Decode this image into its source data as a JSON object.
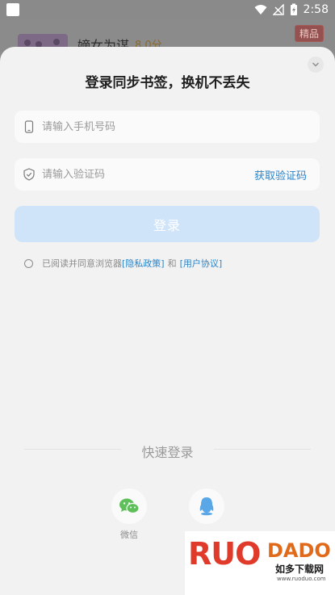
{
  "status_bar": {
    "time": "2:58"
  },
  "background_item": {
    "title": "嫡女为谋",
    "score": "8.0分",
    "badge": "精品"
  },
  "sheet": {
    "title": "登录同步书签，换机不丢失",
    "phone_placeholder": "请输入手机号码",
    "code_placeholder": "请输入验证码",
    "get_code_label": "获取验证码",
    "login_label": "登录",
    "agreement": {
      "prefix": "已阅读并同意浏览器",
      "privacy": "[隐私政策]",
      "and": "和",
      "user": "[用户协议]"
    },
    "quick_login_title": "快速登录",
    "wechat_label": "微信"
  },
  "watermark": {
    "brand": "RUO",
    "brand2": "DADO",
    "cn": "如多下载网",
    "url": "www.ruoduo.com"
  },
  "colors": {
    "accent": "#2b84c8",
    "login_bg": "#cfe4f8",
    "wechat": "#5fbf5a",
    "qq": "#5aa7e8"
  }
}
